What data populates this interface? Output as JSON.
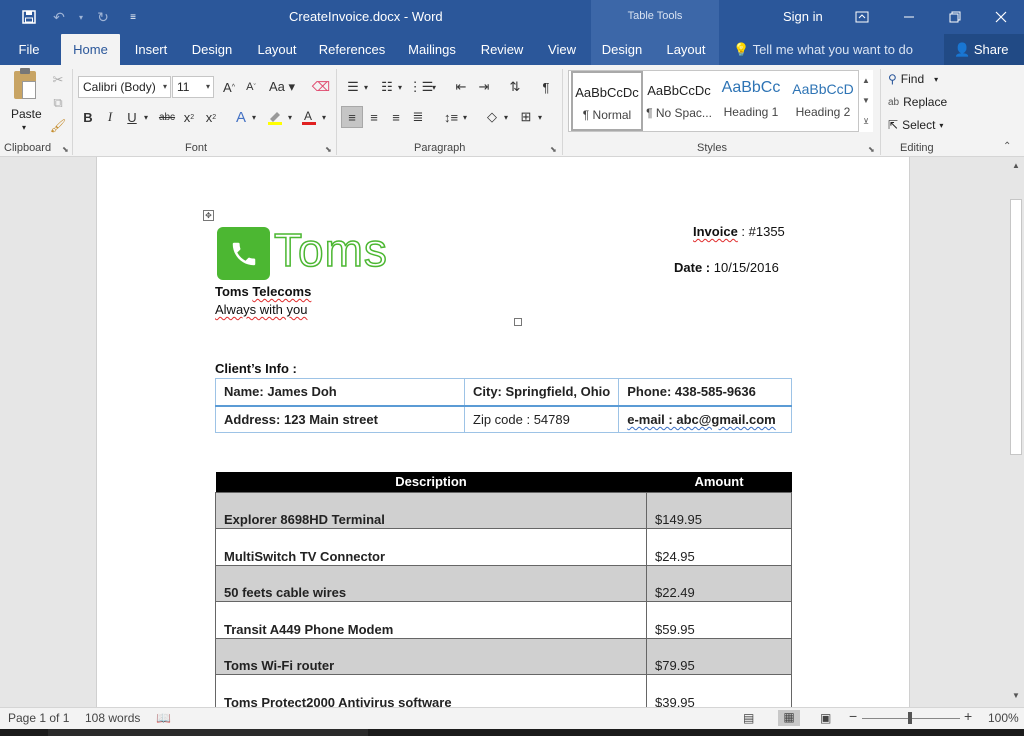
{
  "app": {
    "title": "CreateInvoice.docx  -  Word",
    "context_tab_group": "Table Tools",
    "sign_in": "Sign in",
    "share": "Share",
    "tell_me": "Tell me what you want to do"
  },
  "tabs": [
    {
      "label": "File"
    },
    {
      "label": "Home"
    },
    {
      "label": "Insert"
    },
    {
      "label": "Design"
    },
    {
      "label": "Layout"
    },
    {
      "label": "References"
    },
    {
      "label": "Mailings"
    },
    {
      "label": "Review"
    },
    {
      "label": "View"
    },
    {
      "label": "Design"
    },
    {
      "label": "Layout"
    }
  ],
  "active_tab": "Home",
  "ribbon": {
    "groups": [
      "Clipboard",
      "Font",
      "Paragraph",
      "Styles",
      "Editing"
    ],
    "paste": "Paste",
    "font_name": "Calibri (Body)",
    "font_size": "11",
    "styles": [
      {
        "sample": "AaBbCcDc",
        "name": "¶ Normal"
      },
      {
        "sample": "AaBbCcDc",
        "name": "¶ No Spac..."
      },
      {
        "sample": "AaBbCc",
        "name": "Heading 1"
      },
      {
        "sample": "AaBbCcD",
        "name": "Heading 2"
      }
    ],
    "editing": {
      "find": "Find",
      "replace": "Replace",
      "select": "Select"
    }
  },
  "invoice": {
    "logo_text": "Toms",
    "invoice_label": "Invoice",
    "invoice_value": " : #1355",
    "date_label": "Date :",
    "date_value": " 10/15/2016",
    "company_name_a": "Toms ",
    "company_name_b": "Telecoms",
    "tagline": "Always with you",
    "client_info_label": "Client’s Info :",
    "client_rows": [
      [
        "Name: James Doh",
        "City: Springfield, Ohio",
        "Phone: 438-585-9636"
      ],
      [
        "Address: 123 Main street",
        "Zip code : 54789",
        "e-mail : abc@gmail.com"
      ]
    ],
    "items_header": {
      "description": "Description",
      "amount": "Amount"
    },
    "items": [
      {
        "description": "Explorer 8698HD Terminal",
        "amount": "$149.95"
      },
      {
        "description": "MultiSwitch TV Connector",
        "amount": "$24.95"
      },
      {
        "description": "50 feets cable wires",
        "amount": "$22.49"
      },
      {
        "description": "Transit A449 Phone Modem",
        "amount": "$59.95"
      },
      {
        "description": "Toms Wi-Fi router",
        "amount": "$79.95"
      },
      {
        "description": "Toms Protect2000 Antivirus software",
        "amount": "$39.95"
      }
    ]
  },
  "status": {
    "page": "Page 1 of 1",
    "words": "108 words",
    "zoom": "100%"
  }
}
